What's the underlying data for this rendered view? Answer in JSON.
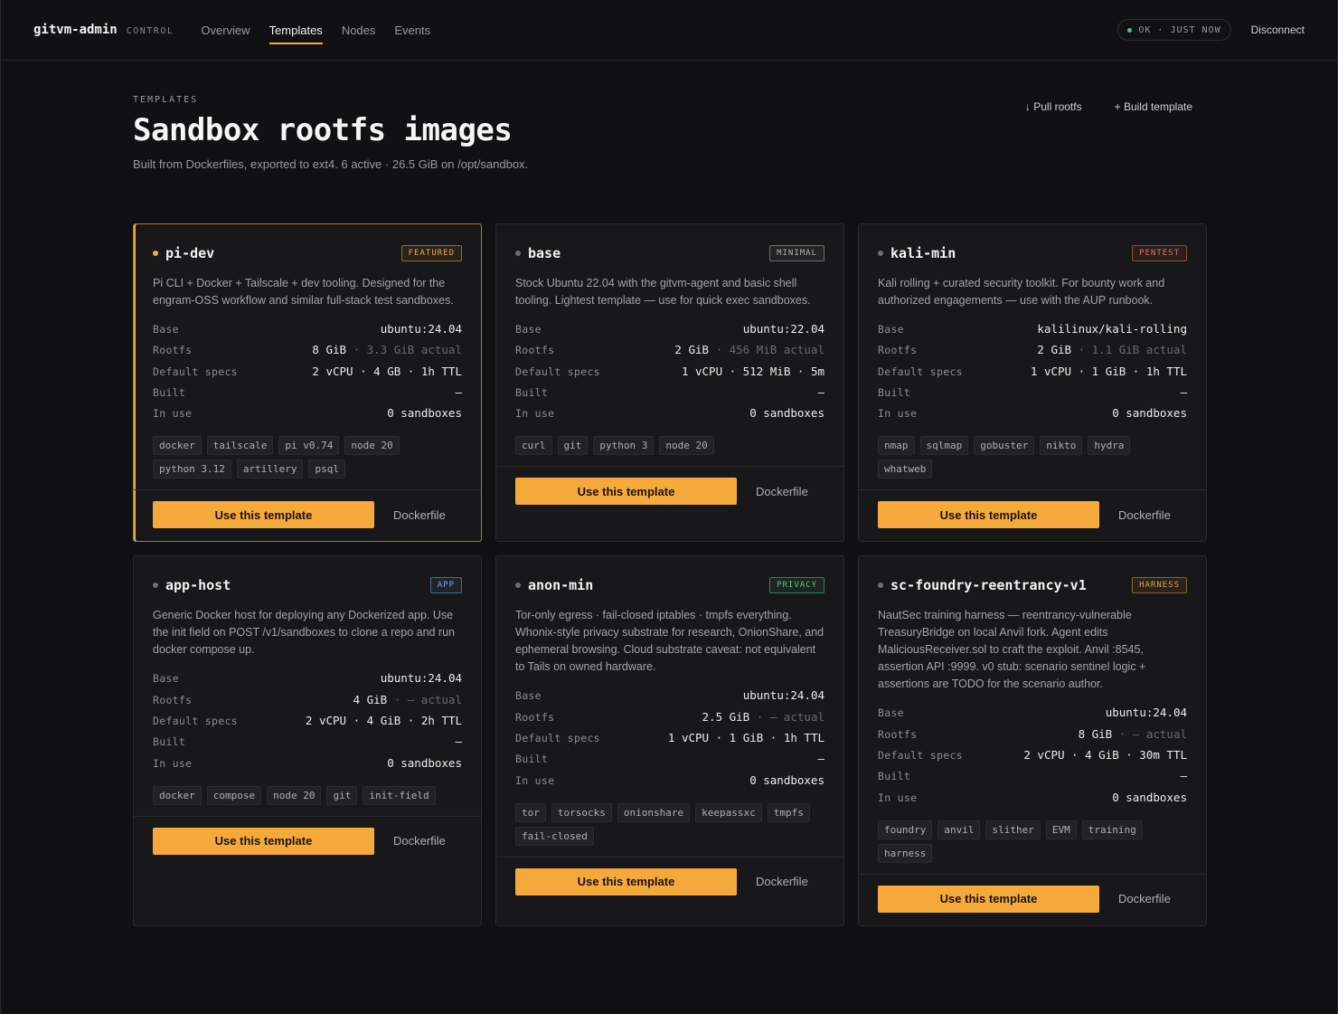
{
  "app": {
    "brand": "gitvm-admin",
    "brand_sub": "CONTROL",
    "nav": [
      "Overview",
      "Templates",
      "Nodes",
      "Events"
    ],
    "active_nav": "Templates",
    "status": "OK · JUST NOW",
    "disconnect": "Disconnect"
  },
  "header": {
    "eyebrow": "TEMPLATES",
    "title": "Sandbox rootfs images",
    "subtitle": "Built from Dockerfiles, exported to ext4. 6 active · 26.5 GiB on /opt/sandbox.",
    "pull_label": "↓ Pull rootfs",
    "build_label": "+ Build template"
  },
  "labels": {
    "base": "Base",
    "rootfs": "Rootfs",
    "specs": "Default specs",
    "built": "Built",
    "in_use": "In use",
    "use_button": "Use this template",
    "dockerfile": "Dockerfile"
  },
  "colors": {
    "accent": "#f5a93b",
    "status_ok": "#4cc38a",
    "badge_featured": "#f5a93b",
    "badge_minimal": "#b0b0b4",
    "badge_pentest": "#e2745e",
    "badge_app": "#7fa3e6",
    "badge_privacy": "#5fc389",
    "badge_harness": "#e3a23f"
  },
  "templates": [
    {
      "name": "pi-dev",
      "badge": "FEATURED",
      "badge_color": "#f5a93b",
      "featured": true,
      "desc": "Pi CLI + Docker + Tailscale + dev tooling. Designed for the engram-OSS workflow and similar full-stack test sandboxes.",
      "base": "ubuntu:24.04",
      "rootfs": "8 GiB",
      "rootfs_actual": "· 3.3 GiB actual",
      "specs": "2 vCPU · 4 GB · 1h TTL",
      "built": "—",
      "in_use": "0 sandboxes",
      "tags": [
        "docker",
        "tailscale",
        "pi v0.74",
        "node 20",
        "python 3.12",
        "artillery",
        "psql"
      ]
    },
    {
      "name": "base",
      "badge": "MINIMAL",
      "badge_color": "#b0b0b4",
      "featured": false,
      "desc": "Stock Ubuntu 22.04 with the gitvm-agent and basic shell tooling. Lightest template — use for quick exec sandboxes.",
      "base": "ubuntu:22.04",
      "rootfs": "2 GiB",
      "rootfs_actual": "· 456 MiB actual",
      "specs": "1 vCPU · 512 MiB · 5m",
      "built": "—",
      "in_use": "0 sandboxes",
      "tags": [
        "curl",
        "git",
        "python 3",
        "node 20"
      ]
    },
    {
      "name": "kali-min",
      "badge": "PENTEST",
      "badge_color": "#e2745e",
      "featured": false,
      "desc": "Kali rolling + curated security toolkit. For bounty work and authorized engagements — use with the AUP runbook.",
      "base": "kalilinux/kali-rolling",
      "rootfs": "2 GiB",
      "rootfs_actual": "· 1.1 GiB actual",
      "specs": "1 vCPU · 1 GiB · 1h TTL",
      "built": "—",
      "in_use": "0 sandboxes",
      "tags": [
        "nmap",
        "sqlmap",
        "gobuster",
        "nikto",
        "hydra",
        "whatweb"
      ]
    },
    {
      "name": "app-host",
      "badge": "APP",
      "badge_color": "#7fa3e6",
      "featured": false,
      "desc": "Generic Docker host for deploying any Dockerized app. Use the init field on POST /v1/sandboxes to clone a repo and run docker compose up.",
      "base": "ubuntu:24.04",
      "rootfs": "4 GiB",
      "rootfs_actual": "· — actual",
      "specs": "2 vCPU · 4 GiB · 2h TTL",
      "built": "—",
      "in_use": "0 sandboxes",
      "tags": [
        "docker",
        "compose",
        "node 20",
        "git",
        "init-field"
      ]
    },
    {
      "name": "anon-min",
      "badge": "PRIVACY",
      "badge_color": "#5fc389",
      "featured": false,
      "desc": "Tor-only egress · fail-closed iptables · tmpfs everything. Whonix-style privacy substrate for research, OnionShare, and ephemeral browsing. Cloud substrate caveat: not equivalent to Tails on owned hardware.",
      "base": "ubuntu:24.04",
      "rootfs": "2.5 GiB",
      "rootfs_actual": "· — actual",
      "specs": "1 vCPU · 1 GiB · 1h TTL",
      "built": "—",
      "in_use": "0 sandboxes",
      "tags": [
        "tor",
        "torsocks",
        "onionshare",
        "keepassxc",
        "tmpfs",
        "fail-closed"
      ]
    },
    {
      "name": "sc-foundry-reentrancy-v1",
      "badge": "HARNESS",
      "badge_color": "#e3a23f",
      "featured": false,
      "desc": "NautSec training harness — reentrancy-vulnerable TreasuryBridge on local Anvil fork. Agent edits MaliciousReceiver.sol to craft the exploit. Anvil :8545, assertion API :9999. v0 stub: scenario sentinel logic + assertions are TODO for the scenario author.",
      "base": "ubuntu:24.04",
      "rootfs": "8 GiB",
      "rootfs_actual": "· — actual",
      "specs": "2 vCPU · 4 GiB · 30m TTL",
      "built": "—",
      "in_use": "0 sandboxes",
      "tags": [
        "foundry",
        "anvil",
        "slither",
        "EVM",
        "training",
        "harness"
      ]
    }
  ]
}
